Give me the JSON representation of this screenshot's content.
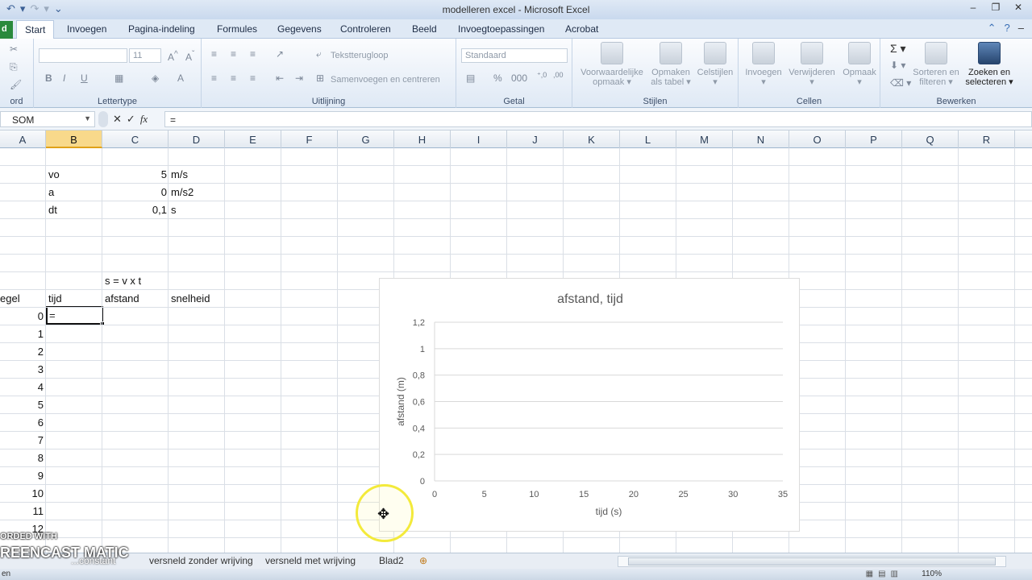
{
  "window": {
    "title": "modelleren excel - Microsoft Excel"
  },
  "tabs": {
    "file": "d",
    "items": [
      "Start",
      "Invoegen",
      "Pagina-indeling",
      "Formules",
      "Gegevens",
      "Controleren",
      "Beeld",
      "Invoegtoepassingen",
      "Acrobat"
    ]
  },
  "ribbon": {
    "groups": {
      "clipboard": "ord",
      "font": "Lettertype",
      "alignment": "Uitlijning",
      "number": "Getal",
      "styles": "Stijlen",
      "cells": "Cellen",
      "edit": "Bewerken"
    },
    "font_size": "11",
    "wrap_text": "Tekstterugloop",
    "merge_center": "Samenvoegen en centreren",
    "number_format": "Standaard",
    "cond_format": [
      "Voorwaardelijke",
      "opmaak"
    ],
    "format_table": [
      "Opmaken",
      "als tabel"
    ],
    "cell_styles": "Celstijlen",
    "insert": "Invoegen",
    "delete": "Verwijderen",
    "format": "Opmaak",
    "sort_filter": [
      "Sorteren en",
      "filteren"
    ],
    "find_select": [
      "Zoeken en",
      "selecteren"
    ]
  },
  "formula_bar": {
    "name_box": "SOM",
    "formula": "="
  },
  "columns": [
    "A",
    "B",
    "C",
    "D",
    "E",
    "F",
    "G",
    "H",
    "I",
    "J",
    "K",
    "L",
    "M",
    "N",
    "O",
    "P",
    "Q",
    "R"
  ],
  "selected_column": "B",
  "cells": {
    "vo_label": "vo",
    "vo_value": "5",
    "vo_unit": "m/s",
    "a_label": "a",
    "a_value": "0",
    "a_unit": "m/s2",
    "dt_label": "dt",
    "dt_value": "0,1",
    "dt_unit": "s",
    "formula_note": "s = v x t",
    "header_a": "egel",
    "header_b": "tijd",
    "header_c": "afstand",
    "header_d": "snelheid",
    "active_entry": "=",
    "row_numbers": [
      "0",
      "1",
      "2",
      "3",
      "4",
      "5",
      "6",
      "7",
      "8",
      "9",
      "10",
      "11",
      "12"
    ]
  },
  "chart_data": {
    "type": "scatter",
    "title": "afstand, tijd",
    "xlabel": "tijd (s)",
    "ylabel": "afstand (m)",
    "xlim": [
      0,
      35
    ],
    "ylim": [
      0,
      1.2
    ],
    "xticks": [
      "0",
      "5",
      "10",
      "15",
      "20",
      "25",
      "30",
      "35"
    ],
    "yticks": [
      "0",
      "0,2",
      "0,4",
      "0,6",
      "0,8",
      "1",
      "1,2"
    ],
    "grid": true,
    "series": []
  },
  "sheets": {
    "items": [
      "...constant",
      "versneld zonder wrijving",
      "versneld met wrijving",
      "Blad2"
    ]
  },
  "status": {
    "mode": "en",
    "zoom": "110%"
  },
  "watermark": {
    "line1": "ORDED WITH",
    "line2": "REENCAST MATIC"
  },
  "colors": {
    "selection": "#f8d98b",
    "file_tab": "#2a8a3c",
    "cursor_ring": "#f3ea3b"
  }
}
